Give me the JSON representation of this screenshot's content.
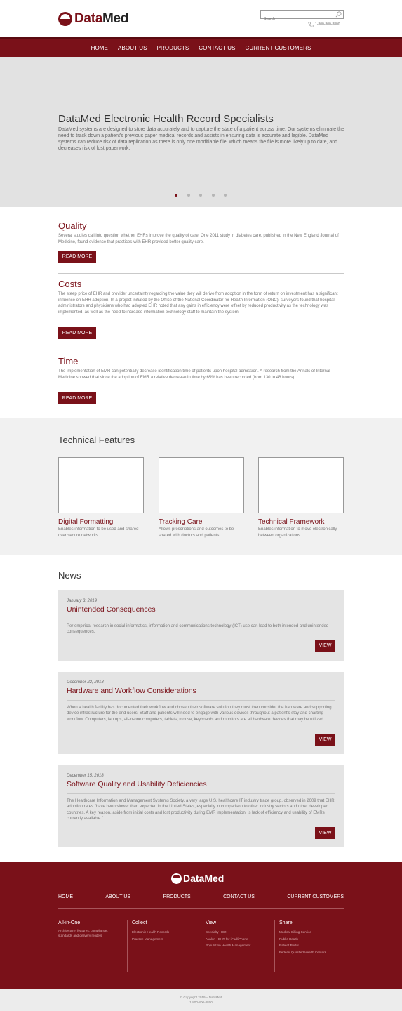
{
  "header": {
    "brand_a": "Data",
    "brand_b": "Med",
    "search_placeholder": "Search",
    "phone": "1-800-800-8800"
  },
  "nav": [
    "HOME",
    "ABOUT US",
    "PRODUCTS",
    "CONTACT US",
    "CURRENT CUSTOMERS"
  ],
  "hero": {
    "title": "DataMed Electronic Health Record Specialists",
    "text": "DataMed systems are designed to store data accurately and to capture the state of a patient across time. Our systems eliminate the need to track down a patient's previous paper medical records and assists in ensuring data is accurate and legible. DataMed systems can reduce risk of data replication as there is only one modifiable file, which means the file is more likely up to date, and decreases risk of lost paperwork.",
    "slides_total": 5,
    "active_slide": 1
  },
  "features": [
    {
      "title": "Quality",
      "text": "Several studies call into question whether EHRs improve the quality of care. One 2011 study in diabetes care, published in the New England Journal of Medicine, found evidence that practices with EHR provided better quality care.",
      "button": "READ MORE"
    },
    {
      "title": "Costs",
      "text": "The steep price of EHR and provider uncertainty regarding the value they will derive from adoption in the form of return on investment has a significant influence on EHR adoption. In a project initiated by the Office of the National Coordinator for Health Information (ONC), surveyors found that hospital administrators and physicians who had adopted EHR noted that any gains in efficiency were offset by reduced productivity as the technology was implemented, as well as the need to increase information technology staff to maintain the system.",
      "button": "READ MORE"
    },
    {
      "title": "Time",
      "text": "The implementation of EMR can potentially decrease identification time of patients upon hospital admission. A research from the Annals of Internal Medicine showed that since the adoption of EMR a relative decrease in time by 65% has been recorded (from 130 to 46 hours).",
      "button": "READ MORE"
    }
  ],
  "technical": {
    "title": "Technical Features",
    "cards": [
      {
        "title": "Digital Formatting",
        "text": "Enables information to be used and shared over secure networks"
      },
      {
        "title": "Tracking Care",
        "text": "Allows prescriptions and outcomes to be shared with doctors and patients"
      },
      {
        "title": "Technical Framework",
        "text": "Enables information to move electronically between organizations"
      }
    ]
  },
  "news": {
    "title": "News",
    "items": [
      {
        "date": "January 3, 2019",
        "title": "Unintended Consequences",
        "text": "Per empirical research in social informatics, information and communications technology (ICT) use can lead to both intended and unintended consequences.",
        "button": "VIEW"
      },
      {
        "date": "December 22, 2018",
        "title": "Hardware and Workflow Considerations",
        "text": "When a health facility has documented their workflow and chosen their software solution they must then consider the hardware and supporting device infrastructure for the end users. Staff and patients will need to engage with various devices throughout a patient's stay and charting workflow. Computers, laptops, all-in-one computers, tablets, mouse, keyboards and monitors are all hardware devices that may be utilized.",
        "button": "VIEW"
      },
      {
        "date": "December 15, 2018",
        "title": "Software Quality and Usability Deficiencies",
        "text": "The Healthcare Information and Management Systems Society, a very large U.S. healthcare IT industry trade group, observed in 2009 that EHR adoption rates \"have been slower than expected in the United States, especially in comparison to other industry sectors and other developed countries. A key reason, aside from initial costs and lost productivity during EMR implementation, is lack of efficiency and usability of EMRs currently available.\"",
        "button": "VIEW"
      }
    ]
  },
  "footer": {
    "brand": "DataMed",
    "nav": [
      "HOME",
      "ABOUT US",
      "PRODUCTS",
      "CONTACT US",
      "CURRENT CUSTOMERS"
    ],
    "columns": [
      {
        "title": "All-in-One",
        "desc": "Architecture, features, compliance, standards and delivery models",
        "links": []
      },
      {
        "title": "Collect",
        "links": [
          "Electronic Health Records",
          "Practice Management"
        ]
      },
      {
        "title": "View",
        "links": [
          "Specialty HER",
          "Avalon - EHR for iPad/iPhone",
          "Population Health Management"
        ]
      },
      {
        "title": "Share",
        "links": [
          "Medical Billing Service",
          "Public Health",
          "Patient Portal",
          "Federal Qualified Health Centers"
        ]
      }
    ],
    "copyright": "© Copyright 2019 – DataMed",
    "phone": "1-800-800-8800"
  },
  "colors": {
    "brand": "#7a1119",
    "hero_bg": "#e2e2e2",
    "section_bg": "#f1f1f1",
    "card_bg": "#e4e4e4"
  },
  "icons": [
    "search-icon",
    "phone-icon",
    "logo-icon"
  ]
}
